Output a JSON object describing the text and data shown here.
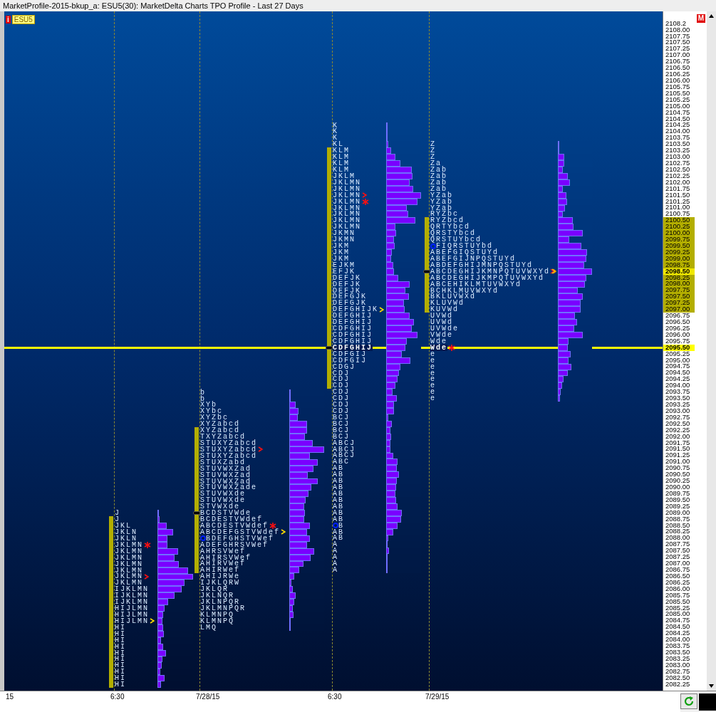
{
  "window": {
    "title": "MarketProfile-2015-bkup_a: ESU5(30): MarketDelta Charts TPO Profile - Last 27 Days"
  },
  "symbol": {
    "info": "i",
    "label": "ESU5"
  },
  "mode_badge": "M",
  "price_axis": [
    {
      "text": "2108.2",
      "kind": "plain"
    },
    {
      "text": "2108.00",
      "kind": "plain"
    },
    {
      "text": "2107.75",
      "kind": "plain"
    },
    {
      "text": "2107.50",
      "kind": "plain"
    },
    {
      "text": "2107.25",
      "kind": "plain"
    },
    {
      "text": "2107.00",
      "kind": "plain"
    },
    {
      "text": "2106.75",
      "kind": "plain"
    },
    {
      "text": "2106.50",
      "kind": "plain"
    },
    {
      "text": "2106.25",
      "kind": "plain"
    },
    {
      "text": "2106.00",
      "kind": "plain"
    },
    {
      "text": "2105.75",
      "kind": "plain"
    },
    {
      "text": "2105.50",
      "kind": "plain"
    },
    {
      "text": "2105.25",
      "kind": "plain"
    },
    {
      "text": "2105.00",
      "kind": "plain"
    },
    {
      "text": "2104.75",
      "kind": "plain"
    },
    {
      "text": "2104.50",
      "kind": "plain"
    },
    {
      "text": "2104.25",
      "kind": "plain"
    },
    {
      "text": "2104.00",
      "kind": "plain"
    },
    {
      "text": "2103.75",
      "kind": "plain"
    },
    {
      "text": "2103.50",
      "kind": "plain"
    },
    {
      "text": "2103.25",
      "kind": "plain"
    },
    {
      "text": "2103.00",
      "kind": "plain"
    },
    {
      "text": "2102.75",
      "kind": "plain"
    },
    {
      "text": "2102.50",
      "kind": "plain"
    },
    {
      "text": "2102.25",
      "kind": "plain"
    },
    {
      "text": "2102.00",
      "kind": "plain"
    },
    {
      "text": "2101.75",
      "kind": "plain"
    },
    {
      "text": "2101.50",
      "kind": "plain"
    },
    {
      "text": "2101.25",
      "kind": "plain"
    },
    {
      "text": "2101.00",
      "kind": "plain"
    },
    {
      "text": "2100.75",
      "kind": "plain"
    },
    {
      "text": "2100.50",
      "kind": "value-area"
    },
    {
      "text": "2100.25",
      "kind": "value-area"
    },
    {
      "text": "2100.00",
      "kind": "value-area"
    },
    {
      "text": "2099.75",
      "kind": "value-area"
    },
    {
      "text": "2099.50",
      "kind": "value-area"
    },
    {
      "text": "2099.25",
      "kind": "value-area"
    },
    {
      "text": "2099.00",
      "kind": "value-area"
    },
    {
      "text": "2098.75",
      "kind": "value-area"
    },
    {
      "text": "2098.50",
      "kind": "poc"
    },
    {
      "text": "2098.25",
      "kind": "value-area"
    },
    {
      "text": "2098.00",
      "kind": "value-area"
    },
    {
      "text": "2097.75",
      "kind": "value-area"
    },
    {
      "text": "2097.50",
      "kind": "value-area"
    },
    {
      "text": "2097.25",
      "kind": "value-area"
    },
    {
      "text": "2097.00",
      "kind": "value-area"
    },
    {
      "text": "2096.75",
      "kind": "plain"
    },
    {
      "text": "2096.50",
      "kind": "plain"
    },
    {
      "text": "2096.25",
      "kind": "plain"
    },
    {
      "text": "2096.00",
      "kind": "plain"
    },
    {
      "text": "2095.75",
      "kind": "plain"
    },
    {
      "text": "2095.50",
      "kind": "last"
    },
    {
      "text": "2095.25",
      "kind": "plain"
    },
    {
      "text": "2095.00",
      "kind": "plain"
    },
    {
      "text": "2094.75",
      "kind": "plain"
    },
    {
      "text": "2094.50",
      "kind": "plain"
    },
    {
      "text": "2094.25",
      "kind": "plain"
    },
    {
      "text": "2094.00",
      "kind": "plain"
    },
    {
      "text": "2093.75",
      "kind": "plain"
    },
    {
      "text": "2093.50",
      "kind": "plain"
    },
    {
      "text": "2093.25",
      "kind": "plain"
    },
    {
      "text": "2093.00",
      "kind": "plain"
    },
    {
      "text": "2092.75",
      "kind": "plain"
    },
    {
      "text": "2092.50",
      "kind": "plain"
    },
    {
      "text": "2092.25",
      "kind": "plain"
    },
    {
      "text": "2092.00",
      "kind": "plain"
    },
    {
      "text": "2091.75",
      "kind": "plain"
    },
    {
      "text": "2091.50",
      "kind": "plain"
    },
    {
      "text": "2091.25",
      "kind": "plain"
    },
    {
      "text": "2091.00",
      "kind": "plain"
    },
    {
      "text": "2090.75",
      "kind": "plain"
    },
    {
      "text": "2090.50",
      "kind": "plain"
    },
    {
      "text": "2090.25",
      "kind": "plain"
    },
    {
      "text": "2090.00",
      "kind": "plain"
    },
    {
      "text": "2089.75",
      "kind": "plain"
    },
    {
      "text": "2089.50",
      "kind": "plain"
    },
    {
      "text": "2089.25",
      "kind": "plain"
    },
    {
      "text": "2089.00",
      "kind": "plain"
    },
    {
      "text": "2088.75",
      "kind": "plain"
    },
    {
      "text": "2088.50",
      "kind": "plain"
    },
    {
      "text": "2088.25",
      "kind": "plain"
    },
    {
      "text": "2088.00",
      "kind": "plain"
    },
    {
      "text": "2087.75",
      "kind": "plain"
    },
    {
      "text": "2087.50",
      "kind": "plain"
    },
    {
      "text": "2087.25",
      "kind": "plain"
    },
    {
      "text": "2087.00",
      "kind": "plain"
    },
    {
      "text": "2086.75",
      "kind": "plain"
    },
    {
      "text": "2086.50",
      "kind": "plain"
    },
    {
      "text": "2086.25",
      "kind": "plain"
    },
    {
      "text": "2086.00",
      "kind": "plain"
    },
    {
      "text": "2085.75",
      "kind": "plain"
    },
    {
      "text": "2085.50",
      "kind": "plain"
    },
    {
      "text": "2085.25",
      "kind": "plain"
    },
    {
      "text": "2085.00",
      "kind": "plain"
    },
    {
      "text": "2084.75",
      "kind": "plain"
    },
    {
      "text": "2084.50",
      "kind": "plain"
    },
    {
      "text": "2084.25",
      "kind": "plain"
    },
    {
      "text": "2084.00",
      "kind": "plain"
    },
    {
      "text": "2083.75",
      "kind": "plain"
    },
    {
      "text": "2083.50",
      "kind": "plain"
    },
    {
      "text": "2083.25",
      "kind": "plain"
    },
    {
      "text": "2083.00",
      "kind": "plain"
    },
    {
      "text": "2082.75",
      "kind": "plain"
    },
    {
      "text": "2082.50",
      "kind": "plain"
    },
    {
      "text": "2082.25",
      "kind": "plain"
    }
  ],
  "profiles": [
    {
      "rows": [
        {
          "tpo": "J",
          "level": 0.02,
          "value_area": false,
          "poc": false,
          "kind": "plain"
        },
        {
          "tpo": "J",
          "level": 0.05,
          "value_area": true,
          "poc": false,
          "kind": "plain"
        },
        {
          "tpo": "JKL",
          "level": 0.25,
          "value_area": true,
          "poc": false,
          "kind": "plain"
        },
        {
          "tpo": "JKLN",
          "level": 0.43,
          "value_area": true,
          "poc": false,
          "kind": "plain"
        },
        {
          "tpo": "JKLN",
          "level": 0.27,
          "value_area": true,
          "poc": false,
          "kind": "plain"
        },
        {
          "tpo": "JKLMN",
          "level": 0.28,
          "value_area": true,
          "poc": false,
          "kind": "asterisk"
        },
        {
          "tpo": "JKLMN",
          "level": 0.57,
          "value_area": true,
          "poc": false,
          "kind": "plain"
        },
        {
          "tpo": "JKLMN",
          "level": 0.47,
          "value_area": true,
          "poc": false,
          "kind": "plain"
        },
        {
          "tpo": "JKLMN",
          "level": 0.59,
          "value_area": true,
          "poc": false,
          "kind": "plain"
        },
        {
          "tpo": "JKLMN",
          "level": 0.85,
          "value_area": true,
          "poc": false,
          "kind": "plain"
        },
        {
          "tpo": "JKLMN",
          "level": 1,
          "value_area": true,
          "poc": false,
          "kind": "caret-red"
        },
        {
          "tpo": "JKLMN",
          "level": 0.76,
          "value_area": true,
          "poc": false,
          "kind": "plain"
        },
        {
          "tpo": "IJKLMN",
          "level": 0.68,
          "value_area": true,
          "poc": false,
          "kind": "plain"
        },
        {
          "tpo": "IJKLMN",
          "level": 0.47,
          "value_area": true,
          "poc": false,
          "kind": "plain"
        },
        {
          "tpo": "IJKLMN",
          "level": 0.29,
          "value_area": true,
          "poc": false,
          "kind": "plain"
        },
        {
          "tpo": "HIJLMN",
          "level": 0.19,
          "value_area": true,
          "poc": false,
          "kind": "plain"
        },
        {
          "tpo": "HIJLMN",
          "level": 0.15,
          "value_area": true,
          "poc": false,
          "kind": "plain"
        },
        {
          "tpo": "HIJLMN",
          "level": 0.14,
          "value_area": true,
          "poc": false,
          "kind": "caret-yellow"
        },
        {
          "tpo": "HI",
          "level": 0.15,
          "value_area": true,
          "poc": false,
          "kind": "plain"
        },
        {
          "tpo": "HI",
          "level": 0.17,
          "value_area": true,
          "poc": false,
          "kind": "plain"
        },
        {
          "tpo": "HI",
          "level": 0.1,
          "value_area": true,
          "poc": false,
          "kind": "plain"
        },
        {
          "tpo": "HI",
          "level": 0.15,
          "value_area": true,
          "poc": false,
          "kind": "plain"
        },
        {
          "tpo": "HI",
          "level": 0.23,
          "value_area": true,
          "poc": false,
          "kind": "plain"
        },
        {
          "tpo": "HI",
          "level": 0.13,
          "value_area": true,
          "poc": false,
          "kind": "plain"
        },
        {
          "tpo": "HI",
          "level": 0.11,
          "value_area": true,
          "poc": false,
          "kind": "plain"
        },
        {
          "tpo": "HI",
          "level": 0.07,
          "value_area": true,
          "poc": false,
          "kind": "plain"
        },
        {
          "tpo": "HI",
          "level": 0.19,
          "value_area": true,
          "poc": false,
          "kind": "plain"
        },
        {
          "tpo": "HI",
          "level": 0.1,
          "value_area": true,
          "poc": false,
          "kind": "plain"
        }
      ]
    },
    {
      "rows": [
        {
          "tpo": "b",
          "level": 0.01,
          "value_area": false,
          "poc": false,
          "kind": "plain"
        },
        {
          "tpo": "b",
          "level": 0.05,
          "value_area": false,
          "poc": false,
          "kind": "plain"
        },
        {
          "tpo": "XYb",
          "level": 0.18,
          "value_area": false,
          "poc": false,
          "kind": "plain"
        },
        {
          "tpo": "XYbc",
          "level": 0.27,
          "value_area": false,
          "poc": false,
          "kind": "plain"
        },
        {
          "tpo": "XYZbc",
          "level": 0.24,
          "value_area": false,
          "poc": false,
          "kind": "plain"
        },
        {
          "tpo": "XYZabcd",
          "level": 0.51,
          "value_area": false,
          "poc": false,
          "kind": "plain"
        },
        {
          "tpo": "XYZabcd",
          "level": 0.51,
          "value_area": true,
          "poc": false,
          "kind": "plain"
        },
        {
          "tpo": "TXYZabcd",
          "level": 0.45,
          "value_area": true,
          "poc": false,
          "kind": "plain"
        },
        {
          "tpo": "STUXYZabcd",
          "level": 0.67,
          "value_area": true,
          "poc": false,
          "kind": "plain"
        },
        {
          "tpo": "STUXYZabcd",
          "level": 1,
          "value_area": true,
          "poc": false,
          "kind": "caret-red"
        },
        {
          "tpo": "STUXYZabcd",
          "level": 0.59,
          "value_area": true,
          "poc": false,
          "kind": "plain"
        },
        {
          "tpo": "STUXZabd",
          "level": 0.82,
          "value_area": true,
          "poc": false,
          "kind": "plain"
        },
        {
          "tpo": "STUVWXZad",
          "level": 0.69,
          "value_area": true,
          "poc": false,
          "kind": "plain"
        },
        {
          "tpo": "STUVWXZad",
          "level": 0.53,
          "value_area": true,
          "poc": false,
          "kind": "plain"
        },
        {
          "tpo": "STUVWXZad",
          "level": 0.82,
          "value_area": true,
          "poc": false,
          "kind": "plain"
        },
        {
          "tpo": "STUVWXZade",
          "level": 0.63,
          "value_area": true,
          "poc": false,
          "kind": "plain"
        },
        {
          "tpo": "STUVWXde",
          "level": 0.55,
          "value_area": true,
          "poc": false,
          "kind": "plain"
        },
        {
          "tpo": "STUVWXde",
          "level": 0.47,
          "value_area": true,
          "poc": false,
          "kind": "plain"
        },
        {
          "tpo": "STVWXde",
          "level": 0.43,
          "value_area": true,
          "poc": false,
          "kind": "plain"
        },
        {
          "tpo": "BCDSTVWde",
          "level": 0.45,
          "value_area": true,
          "poc": true,
          "kind": "plain"
        },
        {
          "tpo": "BCDESTVWdef",
          "level": 0.43,
          "value_area": true,
          "poc": false,
          "kind": "plain"
        },
        {
          "tpo": "ABCDESTVWdef",
          "level": 0.59,
          "value_area": true,
          "poc": false,
          "kind": "asterisk"
        },
        {
          "tpo": "ABCDEFGSTVWdef",
          "level": 0.51,
          "value_area": true,
          "poc": false,
          "kind": "caret-yellow"
        },
        {
          "tpo": "BDEFGHSTVWef",
          "level": 0.59,
          "value_area": true,
          "poc": false,
          "kind": "circle"
        },
        {
          "tpo": "ADEFGHRSVWef",
          "level": 0.51,
          "value_area": true,
          "poc": false,
          "kind": "plain"
        },
        {
          "tpo": "AHRSVWef",
          "level": 0.71,
          "value_area": true,
          "poc": false,
          "kind": "plain"
        },
        {
          "tpo": "AHIRSVWef",
          "level": 0.61,
          "value_area": true,
          "poc": false,
          "kind": "plain"
        },
        {
          "tpo": "AHIRVWef",
          "level": 0.41,
          "value_area": true,
          "poc": false,
          "kind": "plain"
        },
        {
          "tpo": "AHIRWef",
          "level": 0.29,
          "value_area": true,
          "poc": false,
          "kind": "plain"
        },
        {
          "tpo": "AHIJRWe",
          "level": 0.14,
          "value_area": false,
          "poc": false,
          "kind": "plain"
        },
        {
          "tpo": "IJKLQRW",
          "level": 0.06,
          "value_area": false,
          "poc": false,
          "kind": "plain"
        },
        {
          "tpo": "JKLQR",
          "level": 0.1,
          "value_area": false,
          "poc": false,
          "kind": "plain"
        },
        {
          "tpo": "JKLNQR",
          "level": 0.18,
          "value_area": false,
          "poc": false,
          "kind": "plain"
        },
        {
          "tpo": "JKLNPQR",
          "level": 0.14,
          "value_area": false,
          "poc": false,
          "kind": "plain"
        },
        {
          "tpo": "JKLMNPQR",
          "level": 0.1,
          "value_area": false,
          "poc": false,
          "kind": "plain"
        },
        {
          "tpo": "KLMNPQ",
          "level": 0.12,
          "value_area": false,
          "poc": false,
          "kind": "plain"
        },
        {
          "tpo": "KLMNPQ",
          "level": 0.04,
          "value_area": false,
          "poc": false,
          "kind": "plain"
        },
        {
          "tpo": "LMQ",
          "level": 0.01,
          "value_area": false,
          "poc": false,
          "kind": "plain"
        }
      ]
    },
    {
      "rows": [
        {
          "tpo": "K",
          "level": 0.01,
          "value_area": false,
          "poc": false,
          "kind": "plain"
        },
        {
          "tpo": "K",
          "level": 0.01,
          "value_area": false,
          "poc": false,
          "kind": "plain"
        },
        {
          "tpo": "K",
          "level": 0.01,
          "value_area": false,
          "poc": false,
          "kind": "plain"
        },
        {
          "tpo": "KL",
          "level": 0.06,
          "value_area": false,
          "poc": false,
          "kind": "plain"
        },
        {
          "tpo": "KLM",
          "level": 0.14,
          "value_area": true,
          "poc": false,
          "kind": "plain"
        },
        {
          "tpo": "KLM",
          "level": 0.26,
          "value_area": true,
          "poc": false,
          "kind": "plain"
        },
        {
          "tpo": "KLM",
          "level": 0.41,
          "value_area": true,
          "poc": false,
          "kind": "plain"
        },
        {
          "tpo": "KLM",
          "level": 0.73,
          "value_area": true,
          "poc": false,
          "kind": "plain"
        },
        {
          "tpo": "JKLM",
          "level": 0.76,
          "value_area": true,
          "poc": false,
          "kind": "plain"
        },
        {
          "tpo": "JKLMN",
          "level": 0.67,
          "value_area": true,
          "poc": false,
          "kind": "plain"
        },
        {
          "tpo": "JKLMN",
          "level": 0.78,
          "value_area": true,
          "poc": false,
          "kind": "plain"
        },
        {
          "tpo": "JKLMN",
          "level": 1,
          "value_area": true,
          "poc": false,
          "kind": "caret-red"
        },
        {
          "tpo": "JKLMN",
          "level": 0.9,
          "value_area": true,
          "poc": false,
          "kind": "asterisk"
        },
        {
          "tpo": "JKLMN",
          "level": 0.59,
          "value_area": true,
          "poc": false,
          "kind": "plain"
        },
        {
          "tpo": "JKLMN",
          "level": 0.63,
          "value_area": true,
          "poc": false,
          "kind": "plain"
        },
        {
          "tpo": "JKLMN",
          "level": 0.84,
          "value_area": true,
          "poc": false,
          "kind": "plain"
        },
        {
          "tpo": "JKLMN",
          "level": 0.27,
          "value_area": true,
          "poc": false,
          "kind": "plain"
        },
        {
          "tpo": "JKMN",
          "level": 0.29,
          "value_area": true,
          "poc": false,
          "kind": "plain"
        },
        {
          "tpo": "JKMN",
          "level": 0.22,
          "value_area": true,
          "poc": false,
          "kind": "plain"
        },
        {
          "tpo": "JKM",
          "level": 0.24,
          "value_area": true,
          "poc": false,
          "kind": "plain"
        },
        {
          "tpo": "JKM",
          "level": 0.16,
          "value_area": true,
          "poc": false,
          "kind": "plain"
        },
        {
          "tpo": "JKM",
          "level": 0.14,
          "value_area": true,
          "poc": false,
          "kind": "plain"
        },
        {
          "tpo": "EJKM",
          "level": 0.2,
          "value_area": true,
          "poc": false,
          "kind": "plain"
        },
        {
          "tpo": "EFJK",
          "level": 0.22,
          "value_area": true,
          "poc": false,
          "kind": "plain"
        },
        {
          "tpo": "DEFJK",
          "level": 0.35,
          "value_area": true,
          "poc": false,
          "kind": "plain"
        },
        {
          "tpo": "DEFJK",
          "level": 0.67,
          "value_area": true,
          "poc": false,
          "kind": "plain"
        },
        {
          "tpo": "DEFJK",
          "level": 0.55,
          "value_area": true,
          "poc": false,
          "kind": "plain"
        },
        {
          "tpo": "DEFGJK",
          "level": 0.65,
          "value_area": true,
          "poc": false,
          "kind": "plain"
        },
        {
          "tpo": "DEFGJK",
          "level": 0.51,
          "value_area": true,
          "poc": false,
          "kind": "plain"
        },
        {
          "tpo": "DEFGHIJK",
          "level": 0.53,
          "value_area": true,
          "poc": false,
          "kind": "caret-yellow"
        },
        {
          "tpo": "DEFGHIJ",
          "level": 0.67,
          "value_area": true,
          "poc": false,
          "kind": "plain"
        },
        {
          "tpo": "DEFGHIJ",
          "level": 0.8,
          "value_area": true,
          "poc": false,
          "kind": "plain"
        },
        {
          "tpo": "CDFGHIJ",
          "level": 0.73,
          "value_area": true,
          "poc": false,
          "kind": "plain"
        },
        {
          "tpo": "CDFGHIJ",
          "level": 0.9,
          "value_area": true,
          "poc": false,
          "kind": "plain"
        },
        {
          "tpo": "CDFGHIJ",
          "level": 0.59,
          "value_area": true,
          "poc": false,
          "kind": "plain"
        },
        {
          "tpo": "CDFGHIJ",
          "level": 0.56,
          "value_area": true,
          "poc": true,
          "kind": "plain"
        },
        {
          "tpo": "CDFGIJ",
          "level": 0.45,
          "value_area": true,
          "poc": false,
          "kind": "plain"
        },
        {
          "tpo": "CDFGIJ",
          "level": 0.69,
          "value_area": true,
          "poc": false,
          "kind": "plain"
        },
        {
          "tpo": "CDGJ",
          "level": 0.41,
          "value_area": true,
          "poc": false,
          "kind": "plain"
        },
        {
          "tpo": "CDJ",
          "level": 0.37,
          "value_area": true,
          "poc": false,
          "kind": "plain"
        },
        {
          "tpo": "CDJ",
          "level": 0.33,
          "value_area": true,
          "poc": false,
          "kind": "plain"
        },
        {
          "tpo": "CDJ",
          "level": 0.27,
          "value_area": true,
          "poc": false,
          "kind": "plain"
        },
        {
          "tpo": "CDJ",
          "level": 0.18,
          "value_area": false,
          "poc": false,
          "kind": "plain"
        },
        {
          "tpo": "CDJ",
          "level": 0.31,
          "value_area": false,
          "poc": false,
          "kind": "plain"
        },
        {
          "tpo": "CDJ",
          "level": 0.22,
          "value_area": false,
          "poc": false,
          "kind": "plain"
        },
        {
          "tpo": "CDJ",
          "level": 0.22,
          "value_area": false,
          "poc": false,
          "kind": "plain"
        },
        {
          "tpo": "BCJ",
          "level": 0.06,
          "value_area": false,
          "poc": false,
          "kind": "plain"
        },
        {
          "tpo": "BCJ",
          "level": 0.16,
          "value_area": false,
          "poc": false,
          "kind": "plain"
        },
        {
          "tpo": "BCJ",
          "level": 0.12,
          "value_area": false,
          "poc": false,
          "kind": "plain"
        },
        {
          "tpo": "BCJ",
          "level": 0.14,
          "value_area": false,
          "poc": false,
          "kind": "plain"
        },
        {
          "tpo": "ABCJ",
          "level": 0.12,
          "value_area": false,
          "poc": false,
          "kind": "plain"
        },
        {
          "tpo": "ABCJ",
          "level": 0.12,
          "value_area": false,
          "poc": false,
          "kind": "plain"
        },
        {
          "tpo": "ABCJ",
          "level": 0.2,
          "value_area": false,
          "poc": false,
          "kind": "plain"
        },
        {
          "tpo": "ABC",
          "level": 0.33,
          "value_area": false,
          "poc": false,
          "kind": "plain"
        },
        {
          "tpo": "AB",
          "level": 0.31,
          "value_area": false,
          "poc": false,
          "kind": "plain"
        },
        {
          "tpo": "AB",
          "level": 0.37,
          "value_area": false,
          "poc": false,
          "kind": "plain"
        },
        {
          "tpo": "AB",
          "level": 0.31,
          "value_area": false,
          "poc": false,
          "kind": "plain"
        },
        {
          "tpo": "AB",
          "level": 0.29,
          "value_area": false,
          "poc": false,
          "kind": "plain"
        },
        {
          "tpo": "AB",
          "level": 0.27,
          "value_area": false,
          "poc": false,
          "kind": "plain"
        },
        {
          "tpo": "AB",
          "level": 0.29,
          "value_area": false,
          "poc": false,
          "kind": "plain"
        },
        {
          "tpo": "AB",
          "level": 0.33,
          "value_area": false,
          "poc": false,
          "kind": "plain"
        },
        {
          "tpo": "AB",
          "level": 0.45,
          "value_area": false,
          "poc": false,
          "kind": "plain"
        },
        {
          "tpo": "AB",
          "level": 0.43,
          "value_area": false,
          "poc": false,
          "kind": "plain"
        },
        {
          "tpo": "B",
          "level": 0.33,
          "value_area": false,
          "poc": false,
          "kind": "circle"
        },
        {
          "tpo": "AB",
          "level": 0.2,
          "value_area": false,
          "poc": false,
          "kind": "plain"
        },
        {
          "tpo": "AB",
          "level": 0.06,
          "value_area": false,
          "poc": false,
          "kind": "plain"
        },
        {
          "tpo": "A",
          "level": 0.03,
          "value_area": false,
          "poc": false,
          "kind": "plain"
        },
        {
          "tpo": "A",
          "level": 0.08,
          "value_area": false,
          "poc": false,
          "kind": "plain"
        },
        {
          "tpo": "A",
          "level": 0.02,
          "value_area": false,
          "poc": false,
          "kind": "plain"
        },
        {
          "tpo": "A",
          "level": 0.01,
          "value_area": false,
          "poc": false,
          "kind": "plain"
        },
        {
          "tpo": "A",
          "level": 0.01,
          "value_area": false,
          "poc": false,
          "kind": "plain"
        }
      ]
    },
    {
      "rows": [
        {
          "tpo": "Z",
          "level": 0.01,
          "value_area": false,
          "poc": false,
          "kind": "plain"
        },
        {
          "tpo": "Z",
          "level": 0.01,
          "value_area": false,
          "poc": false,
          "kind": "plain"
        },
        {
          "tpo": "Z",
          "level": 0.19,
          "value_area": false,
          "poc": false,
          "kind": "plain"
        },
        {
          "tpo": "Za",
          "level": 0.19,
          "value_area": false,
          "poc": false,
          "kind": "plain"
        },
        {
          "tpo": "Zab",
          "level": 0.14,
          "value_area": false,
          "poc": false,
          "kind": "plain"
        },
        {
          "tpo": "Zab",
          "level": 0.29,
          "value_area": false,
          "poc": false,
          "kind": "plain"
        },
        {
          "tpo": "Zab",
          "level": 0.35,
          "value_area": false,
          "poc": false,
          "kind": "plain"
        },
        {
          "tpo": "Zab",
          "level": 0.14,
          "value_area": false,
          "poc": false,
          "kind": "plain"
        },
        {
          "tpo": "YZab",
          "level": 0.25,
          "value_area": false,
          "poc": false,
          "kind": "plain"
        },
        {
          "tpo": "YZab",
          "level": 0.27,
          "value_area": false,
          "poc": false,
          "kind": "plain"
        },
        {
          "tpo": "YZab",
          "level": 0.21,
          "value_area": false,
          "poc": false,
          "kind": "plain"
        },
        {
          "tpo": "RYZbc",
          "level": 0.14,
          "value_area": false,
          "poc": false,
          "kind": "plain"
        },
        {
          "tpo": "RYZbcd",
          "level": 0.43,
          "value_area": true,
          "poc": false,
          "kind": "plain"
        },
        {
          "tpo": "QRTYbcd",
          "level": 0.46,
          "value_area": true,
          "poc": false,
          "kind": "plain"
        },
        {
          "tpo": "QRSTYbcd",
          "level": 0.72,
          "value_area": true,
          "poc": false,
          "kind": "plain"
        },
        {
          "tpo": "QRSTUYbcd",
          "level": 0.33,
          "value_area": true,
          "poc": false,
          "kind": "plain"
        },
        {
          "tpo": "FIQRSTUYbd",
          "level": 0.68,
          "value_area": true,
          "poc": false,
          "kind": "circle"
        },
        {
          "tpo": "ABEFGIQSTUYd",
          "level": 0.85,
          "value_area": true,
          "poc": false,
          "kind": "plain"
        },
        {
          "tpo": "ABEFGIJNPQSTUYd",
          "level": 0.83,
          "value_area": true,
          "poc": false,
          "kind": "plain"
        },
        {
          "tpo": "ABDEFGHIJMNPQSTUYd",
          "level": 0.77,
          "value_area": true,
          "poc": false,
          "kind": "plain"
        },
        {
          "tpo": "ABCDEGHIJKMNPQTUVWXYd",
          "level": 1,
          "value_area": true,
          "poc": true,
          "kind": "caret-multi"
        },
        {
          "tpo": "ABCDEGHIJKMPQTUVWXYd",
          "level": 0.83,
          "value_area": true,
          "poc": false,
          "kind": "plain"
        },
        {
          "tpo": "ABCEHIKLMTUVWXYd",
          "level": 0.79,
          "value_area": true,
          "poc": false,
          "kind": "plain"
        },
        {
          "tpo": "BCHKLMUVWXYd",
          "level": 0.58,
          "value_area": true,
          "poc": false,
          "kind": "plain"
        },
        {
          "tpo": "BKLUVWXd",
          "level": 0.72,
          "value_area": true,
          "poc": false,
          "kind": "plain"
        },
        {
          "tpo": "KLUVWd",
          "level": 0.66,
          "value_area": true,
          "poc": false,
          "kind": "plain"
        },
        {
          "tpo": "KUVWd",
          "level": 0.66,
          "value_area": true,
          "poc": false,
          "kind": "plain"
        },
        {
          "tpo": "UVWd",
          "level": 0.5,
          "value_area": false,
          "poc": false,
          "kind": "plain"
        },
        {
          "tpo": "UVWd",
          "level": 0.56,
          "value_area": false,
          "poc": false,
          "kind": "plain"
        },
        {
          "tpo": "UVWde",
          "level": 0.48,
          "value_area": false,
          "poc": false,
          "kind": "plain"
        },
        {
          "tpo": "VWde",
          "level": 0.72,
          "value_area": false,
          "poc": false,
          "kind": "plain"
        },
        {
          "tpo": "Wde",
          "level": 0.31,
          "value_area": false,
          "poc": false,
          "kind": "plain"
        },
        {
          "tpo": "Wde",
          "level": 0.29,
          "value_area": false,
          "poc": false,
          "kind": "asterisk"
        },
        {
          "tpo": "e",
          "level": 0.37,
          "value_area": false,
          "poc": false,
          "kind": "plain"
        },
        {
          "tpo": "e",
          "level": 0.31,
          "value_area": false,
          "poc": false,
          "kind": "plain"
        },
        {
          "tpo": "e",
          "level": 0.39,
          "value_area": false,
          "poc": false,
          "kind": "plain"
        },
        {
          "tpo": "e",
          "level": 0.29,
          "value_area": false,
          "poc": false,
          "kind": "plain"
        },
        {
          "tpo": "e",
          "level": 0.17,
          "value_area": false,
          "poc": false,
          "kind": "plain"
        },
        {
          "tpo": "e",
          "level": 0.12,
          "value_area": false,
          "poc": false,
          "kind": "plain"
        },
        {
          "tpo": "e",
          "level": 0.08,
          "value_area": false,
          "poc": false,
          "kind": "plain"
        },
        {
          "tpo": "e",
          "level": 0.06,
          "value_area": false,
          "poc": false,
          "kind": "plain"
        }
      ]
    }
  ],
  "time_axis": [
    "15",
    "6:30",
    "7/28/15",
    "6:30",
    "7/29/15"
  ]
}
